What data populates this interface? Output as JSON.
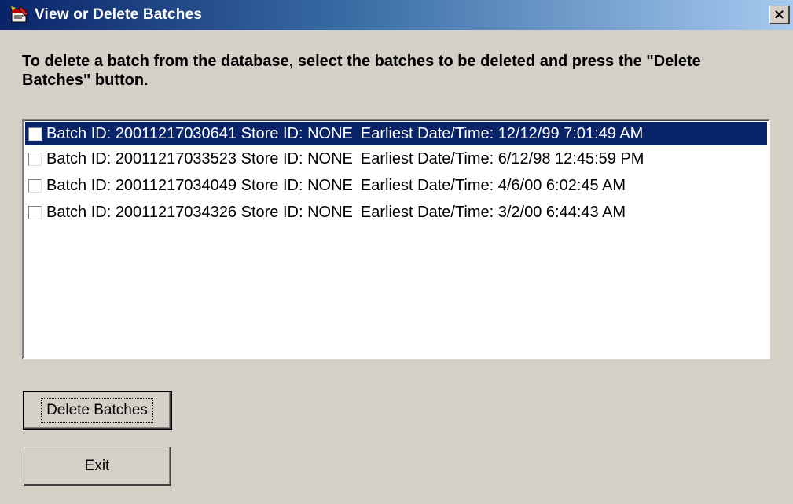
{
  "window": {
    "title": "View or Delete Batches",
    "close_glyph": "×"
  },
  "instructions": "To delete a batch from the database, select the batches to be deleted and press the \"Delete Batches\" button.",
  "batches": [
    {
      "label": "Batch ID: 20011217030641 Store ID: NONE",
      "date": "Earliest Date/Time: 12/12/99 7:01:49 AM",
      "selected": true,
      "checked": false
    },
    {
      "label": "Batch ID: 20011217033523 Store ID: NONE",
      "date": "Earliest Date/Time: 6/12/98 12:45:59 PM",
      "selected": false,
      "checked": false
    },
    {
      "label": "Batch ID: 20011217034049 Store ID: NONE",
      "date": "Earliest Date/Time: 4/6/00 6:02:45 AM",
      "selected": false,
      "checked": false
    },
    {
      "label": "Batch ID: 20011217034326 Store ID: NONE",
      "date": "Earliest Date/Time: 3/2/00 6:44:43 AM",
      "selected": false,
      "checked": false
    }
  ],
  "buttons": {
    "delete_label": "Delete Batches",
    "exit_label": "Exit"
  },
  "colors": {
    "selection": "#0a246a",
    "face": "#d4d0c8"
  },
  "icons": {
    "title": "app-window-icon",
    "close": "close-icon",
    "checkbox": "checkbox-unchecked"
  }
}
